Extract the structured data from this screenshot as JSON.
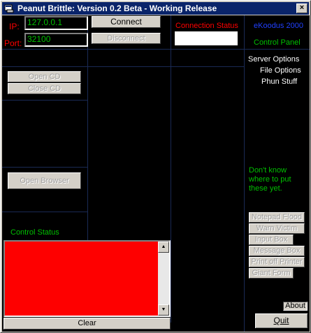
{
  "window": {
    "title": "Peanut Brittle: Version 0.2 Beta - Working Release",
    "close_label": "×"
  },
  "connection": {
    "ip_label": "IP:",
    "ip_value": "127.0.0.1",
    "port_label": "Port:",
    "port_value": "32100",
    "connect_label": "Connect",
    "disconnect_label": "Disconnect",
    "status_title": "Connection Status",
    "status_value": ""
  },
  "branding": {
    "author": "eKoodus 2000",
    "panel_title": "Control Panel"
  },
  "menu": {
    "server_options": "Server Options",
    "file_options": "File Options",
    "phun_stuff": "Phun Stuff"
  },
  "cd": {
    "open_label": "Open CD",
    "close_label": "Close CD"
  },
  "browser": {
    "open_label": "Open Browser"
  },
  "misc": {
    "note": "Don't know where to put these yet.",
    "buttons": [
      "Notepad Flood",
      "Warn Victim",
      "Input Box",
      "Message Box",
      "Print off Printer",
      "Giant Form"
    ]
  },
  "control_status": {
    "title": "Control Status",
    "clear_label": "Clear"
  },
  "footer": {
    "about_label": "About",
    "quit_label": "Quit"
  },
  "colors": {
    "title_bar": "#0a246a",
    "background": "#000000",
    "console": "#fe0000",
    "label_red": "#ff0000",
    "label_green": "#00c000",
    "label_blue": "#2040ff"
  }
}
